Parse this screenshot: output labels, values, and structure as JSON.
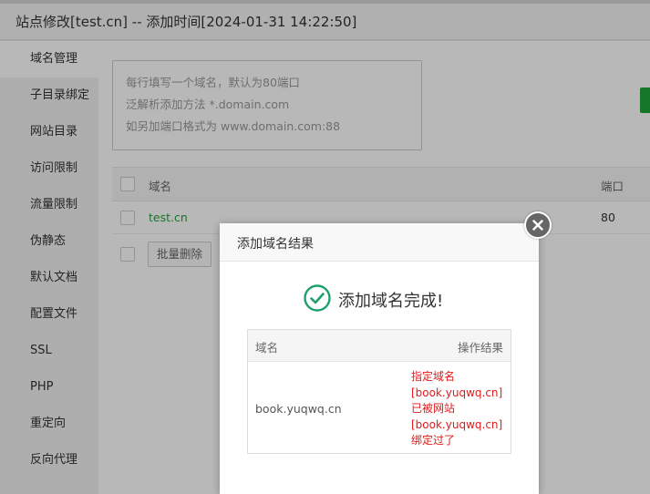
{
  "window": {
    "title": "站点修改[test.cn] -- 添加时间[2024-01-31 14:22:50]"
  },
  "sidebar": {
    "items": [
      {
        "label": "域名管理"
      },
      {
        "label": "子目录绑定"
      },
      {
        "label": "网站目录"
      },
      {
        "label": "访问限制"
      },
      {
        "label": "流量限制"
      },
      {
        "label": "伪静态"
      },
      {
        "label": "默认文档"
      },
      {
        "label": "配置文件"
      },
      {
        "label": "SSL"
      },
      {
        "label": "PHP"
      },
      {
        "label": "重定向"
      },
      {
        "label": "反向代理"
      }
    ]
  },
  "main": {
    "domain_input": {
      "placeholder_lines": [
        "每行填写一个域名，默认为80端口",
        "泛解析添加方法 *.domain.com",
        "如另加端口格式为 www.domain.com:88"
      ]
    },
    "table": {
      "headers": {
        "domain": "域名",
        "port": "端口"
      },
      "rows": [
        {
          "domain": "test.cn",
          "port": "80"
        }
      ]
    },
    "batch_delete_label": "批量删除"
  },
  "dialog": {
    "title": "添加域名结果",
    "success_message": "添加域名完成!",
    "result_table": {
      "headers": {
        "domain": "域名",
        "result": "操作结果"
      },
      "row": {
        "domain": "book.yuqwq.cn",
        "result_lines": [
          "指定域名",
          "[book.yuqwq.cn]",
          "已被网站",
          "[book.yuqwq.cn]",
          "绑定过了"
        ]
      }
    }
  },
  "colors": {
    "accent_green": "#20a53a",
    "error_red": "#e01a1a",
    "success_teal": "#1fa06b"
  }
}
